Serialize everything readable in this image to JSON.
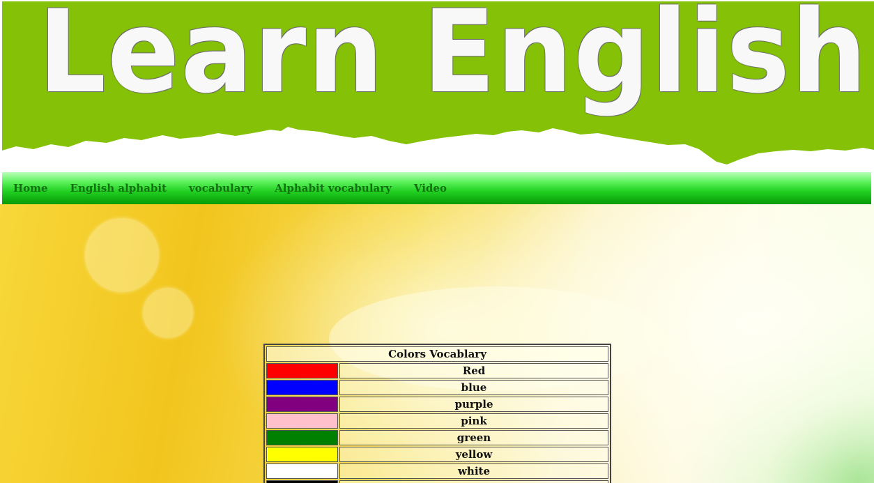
{
  "header": {
    "title": "Learn English"
  },
  "nav": {
    "items": [
      {
        "label": "Home"
      },
      {
        "label": "English alphabit"
      },
      {
        "label": "vocabulary"
      },
      {
        "label": "Alphabit vocabulary"
      },
      {
        "label": "Video"
      }
    ]
  },
  "colors_table": {
    "title": "Colors Vocablary",
    "rows": [
      {
        "name": "Red",
        "swatch": "#ff0000"
      },
      {
        "name": "blue",
        "swatch": "#0000ff"
      },
      {
        "name": "purple",
        "swatch": "#800080"
      },
      {
        "name": "pink",
        "swatch": "#ffc0cb"
      },
      {
        "name": "green",
        "swatch": "#008000"
      },
      {
        "name": "yellow",
        "swatch": "#ffff00"
      },
      {
        "name": "white",
        "swatch": "#ffffff"
      },
      {
        "name": "",
        "swatch": "#000000"
      }
    ]
  },
  "theme": {
    "banner_green": "#84c107",
    "nav_text": "#137013"
  }
}
